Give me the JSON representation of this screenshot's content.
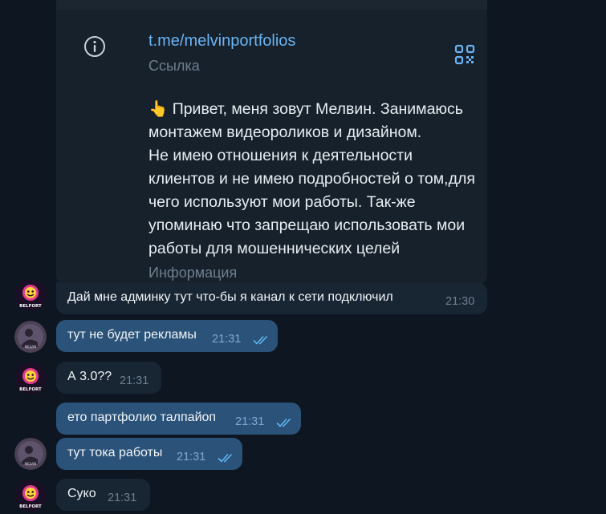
{
  "profile_card": {
    "link": "t.me/melvinportfolios",
    "link_label": "Ссылка",
    "bio_lines": [
      "👆 Привет, меня зовут Мелвин. Занимаюсь",
      "монтажем видеороликов и дизайном.",
      "Не имею отношения к деятельности",
      "клиентов и не имею подробностей о том,для",
      "чего используют мои работы. Так-же",
      "упоминаю что запрещаю использовать мои",
      "работы для мошеннических целей"
    ],
    "bio_label": "Информация"
  },
  "avatars": {
    "incoming_text": "BELFORT",
    "outgoing_text": "MELVIN"
  },
  "messages": [
    {
      "direction": "in",
      "text": "Дай мне админку тут что-бы я канал к сети подключил",
      "time": "21:30",
      "read": false
    },
    {
      "direction": "out",
      "text": "тут не будет рекламы",
      "time": "21:31",
      "read": true
    },
    {
      "direction": "in",
      "text": "А 3.0??",
      "time": "21:31",
      "read": false
    },
    {
      "direction": "out",
      "text": "ето партфолио талпайоп",
      "time": "21:31",
      "read": true
    },
    {
      "direction": "out",
      "text": "тут тока работы",
      "time": "21:31",
      "read": true
    },
    {
      "direction": "in",
      "text": "Суко",
      "time": "21:31",
      "read": false
    }
  ],
  "colors": {
    "background": "#0e1621",
    "incoming_bubble": "#182533",
    "outgoing_bubble": "#2b5278",
    "link": "#6ab3f3",
    "read_ticks": "#5fb7f5"
  }
}
